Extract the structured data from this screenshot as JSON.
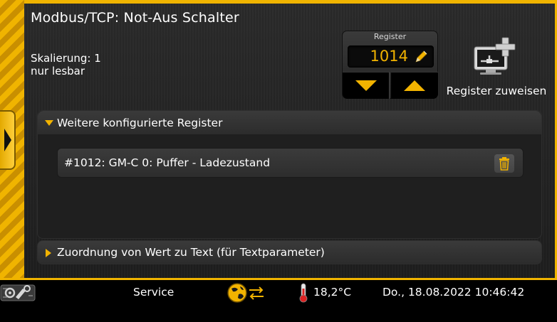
{
  "header": {
    "title": "Modbus/TCP: Not-Aus Schalter",
    "scaling": "Skalierung: 1",
    "access": "nur lesbar"
  },
  "register": {
    "label": "Register",
    "value": "1014",
    "edit_icon": "pencil-icon",
    "down_icon": "arrow-down-icon",
    "up_icon": "arrow-up-icon"
  },
  "assign": {
    "label": "Register zuweisen",
    "icon": "monitor-network-add-icon"
  },
  "further_registers": {
    "header": "Weitere konfigurierte Register",
    "items": [
      {
        "label": "#1012: GM-C 0: Puffer - Ladezustand",
        "delete_icon": "trash-icon"
      }
    ]
  },
  "value_mapping": {
    "header": "Zuordnung von Wert zu Text (für Textparameter)"
  },
  "statusbar": {
    "service_label": "Service",
    "temperature": "18,2°C",
    "datetime": "Do., 18.08.2022 10:46:42"
  },
  "colors": {
    "accent": "#f2b300",
    "background": "#252525"
  }
}
